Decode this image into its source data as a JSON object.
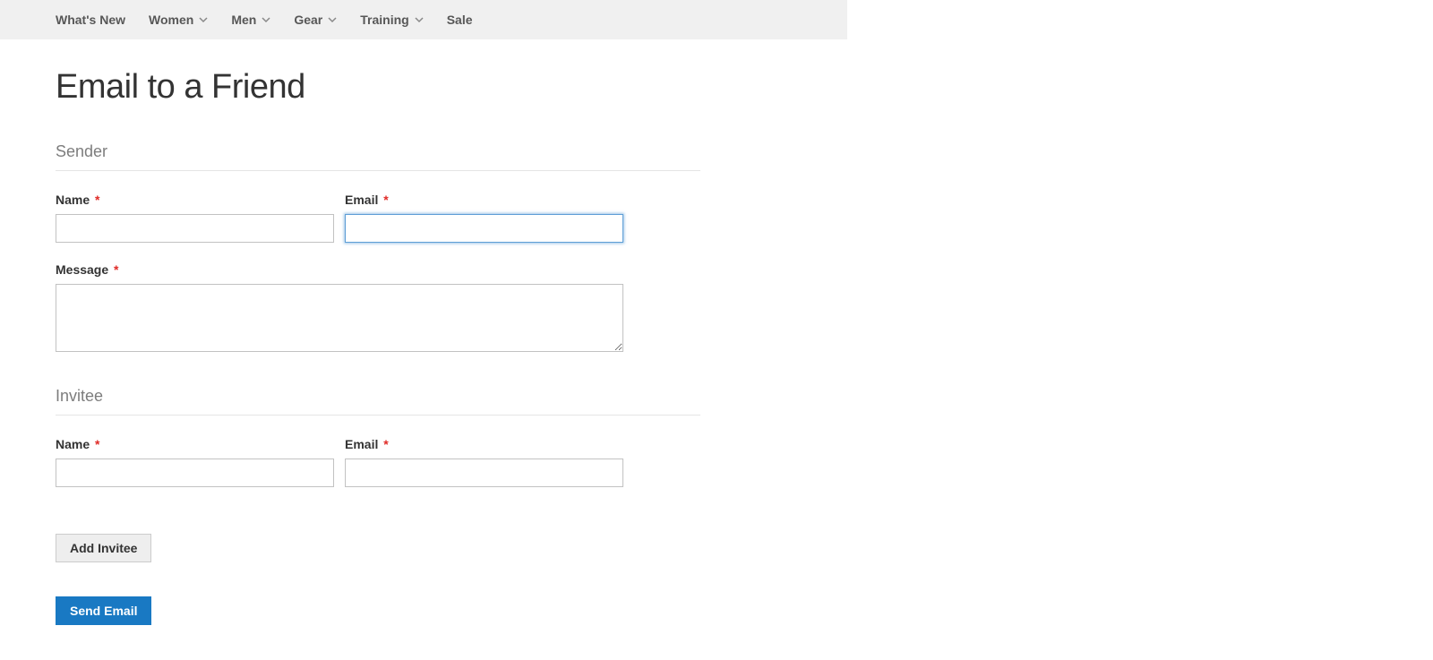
{
  "nav": {
    "items": [
      {
        "label": "What's New",
        "hasDropdown": false
      },
      {
        "label": "Women",
        "hasDropdown": true
      },
      {
        "label": "Men",
        "hasDropdown": true
      },
      {
        "label": "Gear",
        "hasDropdown": true
      },
      {
        "label": "Training",
        "hasDropdown": true
      },
      {
        "label": "Sale",
        "hasDropdown": false
      }
    ]
  },
  "page": {
    "title": "Email to a Friend"
  },
  "form": {
    "sender": {
      "legend": "Sender",
      "name_label": "Name",
      "name_value": "",
      "email_label": "Email",
      "email_value": "",
      "message_label": "Message",
      "message_value": ""
    },
    "invitee": {
      "legend": "Invitee",
      "name_label": "Name",
      "name_value": "",
      "email_label": "Email",
      "email_value": ""
    },
    "add_invitee_label": "Add Invitee",
    "send_email_label": "Send Email",
    "required_mark": "*"
  }
}
